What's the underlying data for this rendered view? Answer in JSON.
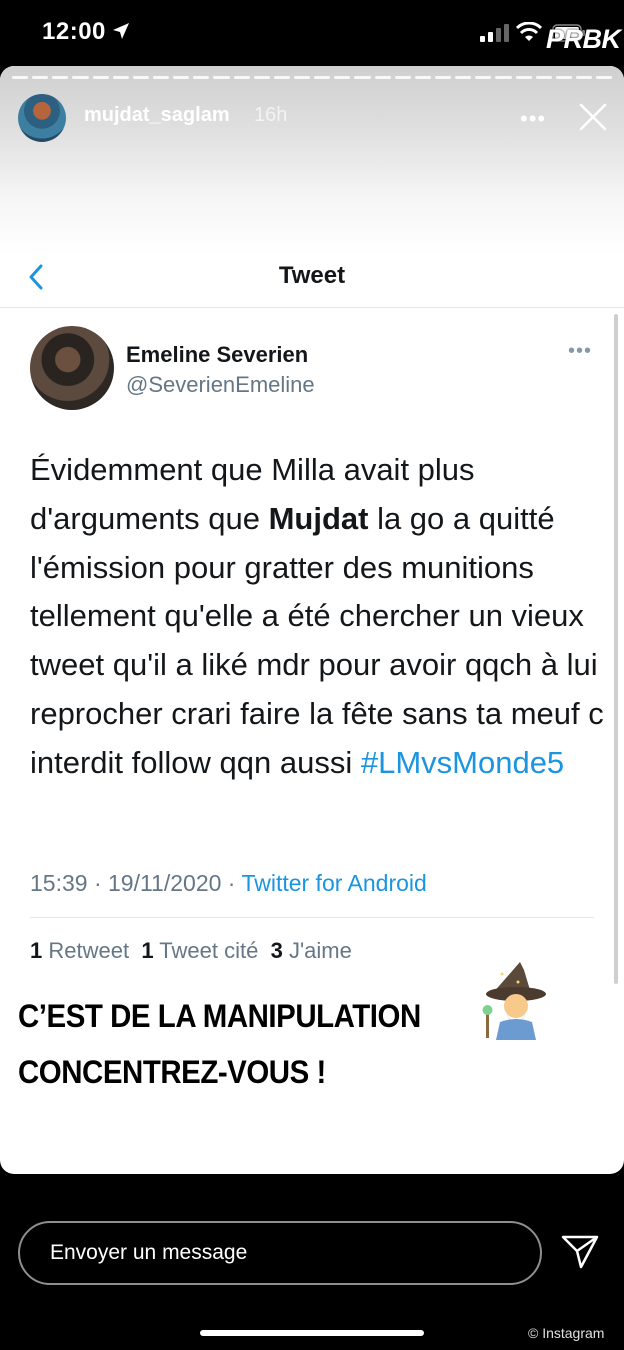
{
  "status_bar": {
    "time": "12:00",
    "watermark": "PRBK",
    "icons": [
      "location-arrow-icon",
      "signal-icon",
      "wifi-icon",
      "battery-icon"
    ]
  },
  "story": {
    "username": "mujdat_saglam",
    "age": "16h",
    "more_label": "•••",
    "segments": 30
  },
  "tweet_header": {
    "title": "Tweet"
  },
  "tweet": {
    "author_name": "Emeline Severien",
    "handle": "@SeverienEmeline",
    "more_label": "•••",
    "text_before": "Évidemment que Milla avait plus d'arguments que ",
    "text_bold": "Mujdat",
    "text_after": " la go a quitté l'émission pour gratter des munitions tellement qu'elle a été chercher un vieux tweet qu'il a liké mdr pour avoir qqch à lui reprocher crari faire la fête sans ta meuf c interdit follow qqn aussi ",
    "hashtag": "#LMvsMonde5",
    "timestamp": "15:39 · 19/11/2020 · ",
    "client": "Twitter for Android",
    "stats": {
      "retweets_count": "1",
      "retweets_label": "Retweet",
      "quotes_count": "1",
      "quotes_label": "Tweet cité",
      "likes_count": "3",
      "likes_label": "J'aime"
    }
  },
  "caption": {
    "line1": "C’EST DE LA MANIPULATION",
    "line2": "CONCENTREZ-VOUS !",
    "sticker": "wizard-emoji"
  },
  "reply_bar": {
    "placeholder": "Envoyer un message"
  },
  "footer": {
    "watermark": "© Instagram"
  },
  "colors": {
    "twitter_blue": "#1b95e0",
    "twitter_gray": "#657786",
    "text_dark": "#14171a"
  }
}
